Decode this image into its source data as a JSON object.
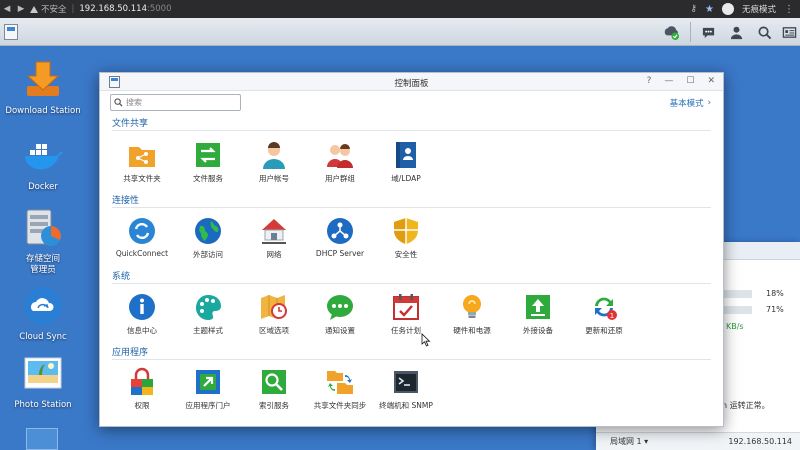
{
  "browser": {
    "back_label": "◀",
    "forward_label": "▶",
    "security_label": "不安全",
    "url_host": "192.168.50.114",
    "url_port": ":5000",
    "mode_label": "无痕模式"
  },
  "desktop": {
    "icons": [
      {
        "label": "Download Station"
      },
      {
        "label": "Docker"
      },
      {
        "label": "存储空间\n管理员"
      },
      {
        "label": "Cloud Sync"
      },
      {
        "label": "Photo Station"
      }
    ]
  },
  "resource_window": {
    "cpu_percent": "18%",
    "ram_percent": "71%",
    "cpu_value": 18,
    "ram_value": 71,
    "speed": "KB/s",
    "status_text": "n 运转正常。",
    "network_label": "局域网 1",
    "network_ip": "192.168.50.114"
  },
  "control_panel": {
    "title": "控制面板",
    "search_placeholder": "搜索",
    "mode_link": "基本模式",
    "help_label": "?",
    "minimize_label": "—",
    "maximize_label": "☐",
    "close_label": "✕",
    "sections": [
      {
        "title": "文件共享",
        "items": [
          {
            "label": "共享文件夹",
            "icon": "shared-folder-icon"
          },
          {
            "label": "文件服务",
            "icon": "file-services-icon"
          },
          {
            "label": "用户帐号",
            "icon": "user-icon"
          },
          {
            "label": "用户群组",
            "icon": "group-icon"
          },
          {
            "label": "域/LDAP",
            "icon": "domain-ldap-icon"
          }
        ]
      },
      {
        "title": "连接性",
        "items": [
          {
            "label": "QuickConnect",
            "icon": "quickconnect-icon"
          },
          {
            "label": "外部访问",
            "icon": "external-access-icon"
          },
          {
            "label": "网络",
            "icon": "network-icon"
          },
          {
            "label": "DHCP Server",
            "icon": "dhcp-server-icon"
          },
          {
            "label": "安全性",
            "icon": "security-icon"
          }
        ]
      },
      {
        "title": "系统",
        "items": [
          {
            "label": "信息中心",
            "icon": "info-center-icon"
          },
          {
            "label": "主题样式",
            "icon": "theme-icon"
          },
          {
            "label": "区域选项",
            "icon": "regional-options-icon"
          },
          {
            "label": "通知设置",
            "icon": "notification-icon"
          },
          {
            "label": "任务计划",
            "icon": "task-scheduler-icon"
          },
          {
            "label": "硬件和电源",
            "icon": "hardware-power-icon"
          },
          {
            "label": "外接设备",
            "icon": "external-devices-icon"
          },
          {
            "label": "更新和还原",
            "icon": "update-restore-icon"
          }
        ]
      },
      {
        "title": "应用程序",
        "items": [
          {
            "label": "权限",
            "icon": "privileges-icon"
          },
          {
            "label": "应用程序门户",
            "icon": "application-portal-icon"
          },
          {
            "label": "索引服务",
            "icon": "indexing-service-icon"
          },
          {
            "label": "共享文件夹同步",
            "icon": "shared-folder-sync-icon"
          },
          {
            "label": "终端机和 SNMP",
            "icon": "terminal-snmp-icon"
          }
        ]
      }
    ]
  },
  "colors": {
    "desktop_bg": "#3a78c8",
    "section_title": "#1e62a8",
    "link": "#2870b8"
  }
}
